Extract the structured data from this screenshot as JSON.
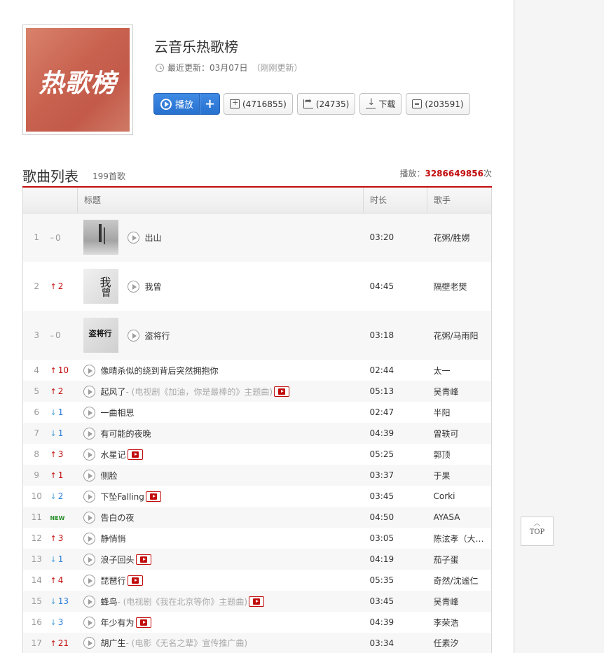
{
  "playlist": {
    "cover_text": "热歌榜",
    "title": "云音乐热歌榜",
    "updated_label": "最近更新：03月07日",
    "updated_note": "（刚刚更新）"
  },
  "actions": {
    "play_label": "播放",
    "add_label": "+",
    "favorite_count": "(4716855)",
    "share_count": "(24735)",
    "download_label": "下载",
    "comment_count": "(203591)"
  },
  "list": {
    "title": "歌曲列表",
    "count": "199首歌",
    "play_label": "播放：",
    "play_count": "3286649856",
    "play_suffix": "次",
    "columns": [
      "",
      "标题",
      "时长",
      "歌手"
    ]
  },
  "songs": [
    {
      "rank": "1",
      "trend": "same",
      "change": "0",
      "name": "出山",
      "sub": "",
      "mv": false,
      "duration": "03:20",
      "artist": "花粥/胜娚"
    },
    {
      "rank": "2",
      "trend": "up",
      "change": "2",
      "name": "我曾",
      "sub": "",
      "mv": false,
      "duration": "04:45",
      "artist": "隔壁老樊"
    },
    {
      "rank": "3",
      "trend": "same",
      "change": "0",
      "name": "盗将行",
      "sub": "",
      "mv": false,
      "duration": "03:18",
      "artist": "花粥/马雨阳"
    },
    {
      "rank": "4",
      "trend": "up",
      "change": "10",
      "name": "像晴杀似的绕到背后突然拥抱你",
      "sub": "",
      "mv": false,
      "duration": "02:44",
      "artist": "太一"
    },
    {
      "rank": "5",
      "trend": "up",
      "change": "2",
      "name": "起风了",
      "sub": " - (电视剧《加油，你是最棒的》主题曲)",
      "mv": true,
      "duration": "05:13",
      "artist": "吴青峰"
    },
    {
      "rank": "6",
      "trend": "down",
      "change": "1",
      "name": "一曲相思",
      "sub": "",
      "mv": false,
      "duration": "02:47",
      "artist": "半阳"
    },
    {
      "rank": "7",
      "trend": "down",
      "change": "1",
      "name": "有可能的夜晚",
      "sub": "",
      "mv": false,
      "duration": "04:39",
      "artist": "曾轶可"
    },
    {
      "rank": "8",
      "trend": "up",
      "change": "3",
      "name": "水星记",
      "sub": "",
      "mv": true,
      "duration": "05:25",
      "artist": "郭顶"
    },
    {
      "rank": "9",
      "trend": "up",
      "change": "1",
      "name": "侧脸",
      "sub": "",
      "mv": false,
      "duration": "03:37",
      "artist": "于果"
    },
    {
      "rank": "10",
      "trend": "down",
      "change": "2",
      "name": "下坠Falling",
      "sub": "",
      "mv": true,
      "duration": "03:45",
      "artist": "Corki"
    },
    {
      "rank": "11",
      "trend": "new",
      "change": "NEW",
      "name": "告白の夜",
      "sub": "",
      "mv": false,
      "duration": "04:50",
      "artist": "AYASA"
    },
    {
      "rank": "12",
      "trend": "up",
      "change": "3",
      "name": "静悄悄",
      "sub": "",
      "mv": false,
      "duration": "03:05",
      "artist": "陈泫孝（大…"
    },
    {
      "rank": "13",
      "trend": "down",
      "change": "1",
      "name": "浪子回头",
      "sub": "",
      "mv": true,
      "duration": "04:19",
      "artist": "茄子蛋"
    },
    {
      "rank": "14",
      "trend": "up",
      "change": "4",
      "name": "琵琶行",
      "sub": "",
      "mv": true,
      "duration": "05:35",
      "artist": "奇然/沈谧仁"
    },
    {
      "rank": "15",
      "trend": "down",
      "change": "13",
      "name": "蜂鸟",
      "sub": " - (电视剧《我在北京等你》主题曲)",
      "mv": true,
      "duration": "03:45",
      "artist": "吴青峰"
    },
    {
      "rank": "16",
      "trend": "down",
      "change": "3",
      "name": "年少有为",
      "sub": "",
      "mv": true,
      "duration": "04:39",
      "artist": "李荣浩"
    },
    {
      "rank": "17",
      "trend": "up",
      "change": "21",
      "name": "胡广生",
      "sub": " - (电影《无名之辈》宣传推广曲)",
      "mv": false,
      "duration": "03:34",
      "artist": "任素汐"
    }
  ],
  "back_to_top": {
    "label": "TOP"
  }
}
